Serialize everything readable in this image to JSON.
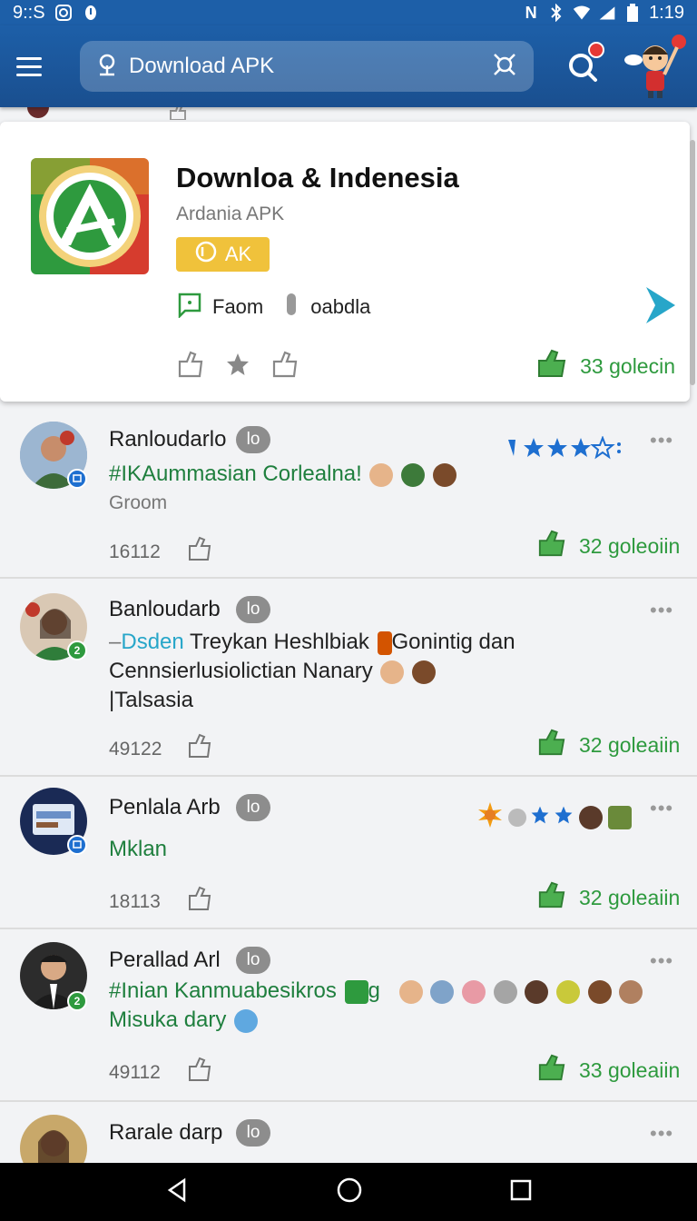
{
  "status": {
    "time_left": "9::S",
    "time_right": "1:19"
  },
  "search": {
    "placeholder": "Download APK"
  },
  "app_card": {
    "title": "Downloa & Indenesia",
    "subtitle": "Ardania APK",
    "badge": "AK",
    "meta_a": "Faom",
    "meta_b": "oabdla",
    "likes": "33 golecin"
  },
  "posts": [
    {
      "name": "Ranloudarlo",
      "level": "lo",
      "tag": "#IKAummasian Corlealna!",
      "subline": "Groom",
      "count": "16112",
      "likes": "32 goleoiin"
    },
    {
      "name": "Banloudarb",
      "level": "lo",
      "text_dash": "–",
      "text_green": "Dsden",
      "text_1": " Treykan Heshlbiak",
      "text_1b": "Gonintig dan",
      "text_2": "Cennsierlusiolictian  Nanary",
      "text_3": "|Talsasia",
      "count": "49122",
      "likes": "32 goleaiin"
    },
    {
      "name": "Penlala Arb",
      "level": "lo",
      "tag": "Mklan",
      "count": "18113",
      "likes": "32 goleaiin"
    },
    {
      "name": "Perallad Arl",
      "level": "lo",
      "tag": "#Inian Kanmuabesikros",
      "tag_tail": "g",
      "tag_2": "Misuka dary",
      "count": "49112",
      "likes": "33 goleaiin"
    },
    {
      "name": "Rarale darp",
      "level": "lo"
    }
  ],
  "colors": {
    "primary": "#1d5fa8",
    "green": "#2e9a3e",
    "tag_green": "#1f7f3e",
    "badge_yellow": "#f0c23b"
  }
}
